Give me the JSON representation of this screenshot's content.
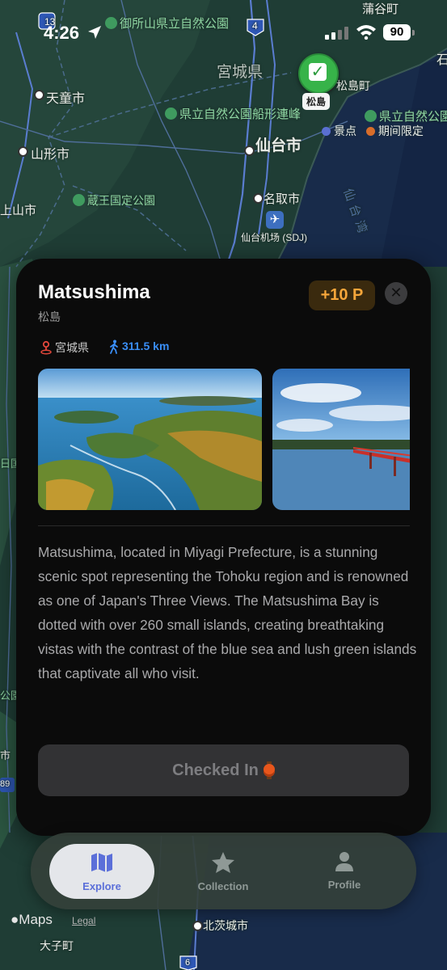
{
  "status_bar": {
    "time": "4:26",
    "battery": "90"
  },
  "map": {
    "labels": {
      "park_top": "御所山県立自然公園",
      "pref": "宮城県",
      "tendo": "天童市",
      "park_funagata": "県立自然公園船形連峰",
      "park_right": "県立自然公園松",
      "yamagata": "山形市",
      "sendai": "仙台市",
      "park_zao": "蔵王国定公園",
      "natori": "名取市",
      "kaminoyama": "上山市",
      "airport": "仙台机场 (SDJ)",
      "matsushima_town": "松島町",
      "sea": "仙台湾",
      "edge_top": "蒲谷町",
      "edge_right_top": "石",
      "route_13": "13",
      "route_4": "4",
      "left_edge_1": "日国",
      "left_edge_2": "公園",
      "left_edge_3": "市",
      "left_edge_4": "89",
      "kitaibaraki": "北茨城市",
      "daigo": "大子町",
      "route_6": "6"
    },
    "pin_label": "松島",
    "legend": [
      {
        "label": "景点",
        "color": "#5a6fd1"
      },
      {
        "label": "期间限定",
        "color": "#d86d2a"
      }
    ],
    "logo": "Maps",
    "legal": "Legal"
  },
  "card": {
    "title": "Matsushima",
    "subtitle": "松島",
    "points": "+10 P",
    "prefecture": "宮城県",
    "distance": "311.5 km",
    "description": "Matsushima, located in Miyagi Prefecture, is a stunning scenic spot representing the Tohoku region and is renowned as one of Japan's Three Views. The Matsushima Bay is dotted with over 260 small islands, creating breathtaking vistas with the contrast of the blue sea and lush green islands that captivate all who visit.",
    "checkin_label": "Checked In",
    "accent": "#f6a63a"
  },
  "tabbar": {
    "tabs": [
      {
        "label": "Explore",
        "active": true
      },
      {
        "label": "Collection",
        "active": false
      },
      {
        "label": "Profile",
        "active": false
      }
    ],
    "active_color": "#5b6fd9"
  }
}
